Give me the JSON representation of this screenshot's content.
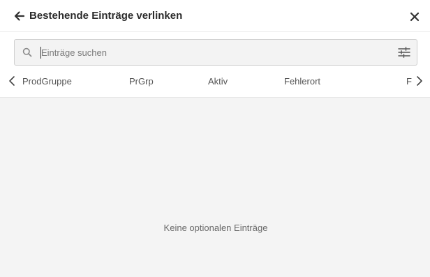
{
  "header": {
    "title": "Bestehende Einträge verlinken",
    "back_icon": "arrow-left-icon",
    "close_icon": "close-icon"
  },
  "search": {
    "placeholder": "Einträge suchen",
    "value": "",
    "search_icon": "magnifier-icon",
    "filter_icon": "sliders-icon"
  },
  "tabs": {
    "items": [
      {
        "label": "ProdGruppe"
      },
      {
        "label": "PrGrp"
      },
      {
        "label": "Aktiv"
      },
      {
        "label": "Fehlerort"
      },
      {
        "label": "F"
      }
    ],
    "prev_icon": "chevron-left-icon",
    "next_icon": "chevron-right-icon"
  },
  "content": {
    "empty_message": "Keine optionalen Einträge"
  },
  "colors": {
    "content_background": "#f4f4f4",
    "search_background": "#f3f3f3",
    "text": "#2b2b2b"
  }
}
